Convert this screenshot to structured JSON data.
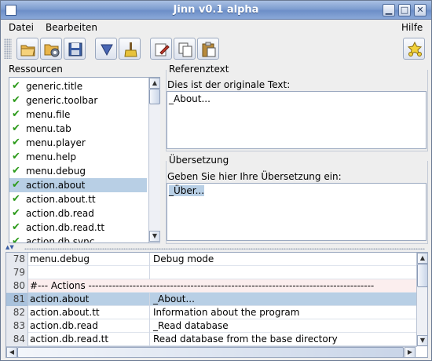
{
  "window": {
    "title": "Jinn v0.1 alpha"
  },
  "menubar": {
    "items": [
      "Datei",
      "Bearbeiten"
    ],
    "help": "Hilfe"
  },
  "toolbar": {
    "buttons": [
      "open-folder-icon",
      "open-settings-icon",
      "save-icon",
      "filter-icon",
      "clean-icon",
      "edit-icon",
      "copy-icon",
      "paste-icon"
    ],
    "right_button": "wizard-icon"
  },
  "resources": {
    "title": "Ressourcen",
    "items": [
      "generic.title",
      "generic.toolbar",
      "menu.file",
      "menu.tab",
      "menu.player",
      "menu.help",
      "menu.debug",
      "action.about",
      "action.about.tt",
      "action.db.read",
      "action.db.read.tt",
      "action.db.sync"
    ],
    "selected_index": 7,
    "check_color": "#2c9a1a"
  },
  "reference": {
    "title": "Referenztext",
    "label": "Dies ist der originale Text:",
    "text": "_About..."
  },
  "translation": {
    "title": "Übersetzung",
    "label": "Geben Sie hier Ihre Übersetzung ein:",
    "text": "_Über..."
  },
  "table": {
    "rows": [
      {
        "num": "78",
        "key": "menu.debug",
        "value": "Debug mode",
        "kind": "normal"
      },
      {
        "num": "79",
        "key": "",
        "value": "",
        "kind": "normal"
      },
      {
        "num": "80",
        "key": "#--- Actions ------------------------------------------------------------------------------------",
        "value": "",
        "kind": "comment"
      },
      {
        "num": "81",
        "key": "action.about",
        "value": "_About...",
        "kind": "selected"
      },
      {
        "num": "82",
        "key": "action.about.tt",
        "value": "Information about the program",
        "kind": "normal"
      },
      {
        "num": "83",
        "key": "action.db.read",
        "value": "_Read database",
        "kind": "normal"
      },
      {
        "num": "84",
        "key": "action.db.read.tt",
        "value": "Read database from the base directory",
        "kind": "normal"
      }
    ]
  },
  "colors": {
    "selection": "#b8cfe5",
    "comment_row": "#fbeeee",
    "titlebar": "#7f9ed0"
  }
}
